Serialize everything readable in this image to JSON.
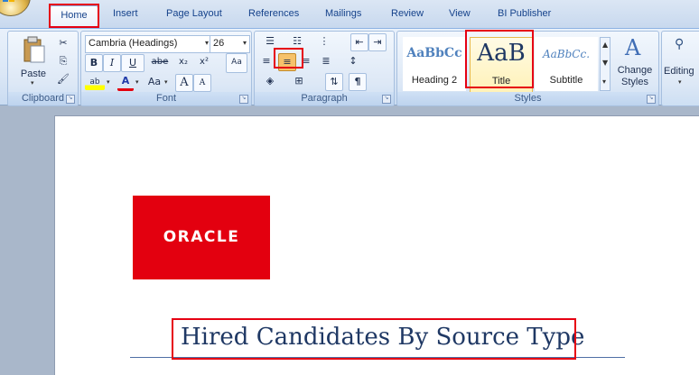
{
  "tabs": [
    "Home",
    "Insert",
    "Page Layout",
    "References",
    "Mailings",
    "Review",
    "View",
    "BI Publisher"
  ],
  "clipboard": {
    "paste_label": "Paste",
    "group_label": "Clipboard"
  },
  "font": {
    "family": "Cambria (Headings)",
    "size": "26",
    "group_label": "Font",
    "bold": "B",
    "italic": "I",
    "underline": "U",
    "strike": "abe",
    "subscript": "x₂",
    "superscript": "x²",
    "change_case": "Aa",
    "grow": "A",
    "shrink": "A",
    "highlight_glyph": "ab",
    "font_color_glyph": "A"
  },
  "paragraph": {
    "group_label": "Paragraph",
    "show_marks": "¶"
  },
  "styles": {
    "group_label": "Styles",
    "items": [
      {
        "sample": "AaBbCc",
        "name": "Heading 2"
      },
      {
        "sample": "AaB",
        "name": "Title"
      },
      {
        "sample": "AaBbCc.",
        "name": "Subtitle"
      }
    ],
    "change_styles": "Change Styles"
  },
  "editing": {
    "label": "Editing"
  },
  "document": {
    "logo_text": "ORACLE",
    "title": "Hired Candidates By Source Type"
  },
  "colors": {
    "oracle_red": "#e3000f",
    "highlight_red": "#e60012",
    "title_blue": "#1f3864"
  }
}
